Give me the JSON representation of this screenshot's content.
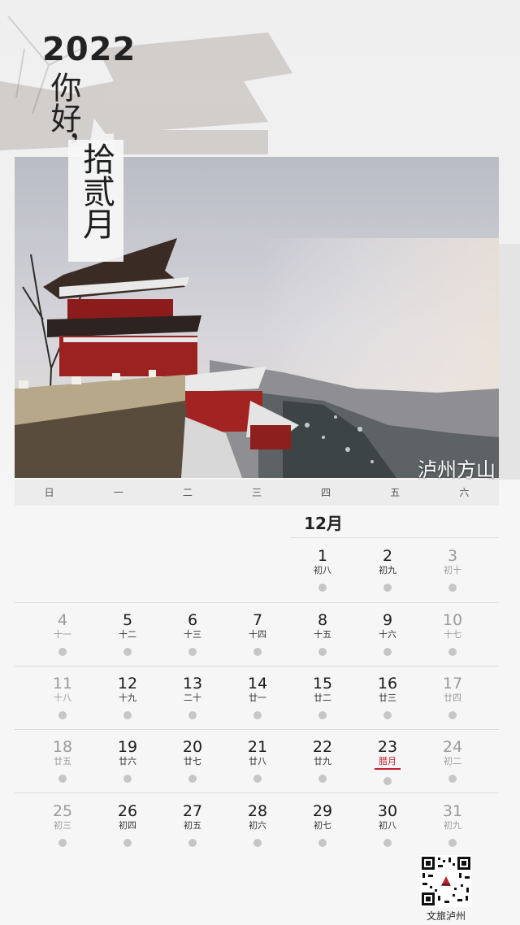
{
  "header": {
    "year": "2022",
    "greeting": "你好，",
    "month_title": "拾贰月"
  },
  "photo": {
    "caption": "泸州方山"
  },
  "calendar": {
    "weekdays": [
      "日",
      "一",
      "二",
      "三",
      "四",
      "五",
      "六"
    ],
    "month_label": "12月",
    "weeks": [
      [
        null,
        null,
        null,
        null,
        {
          "day": "1",
          "lunar": "初八"
        },
        {
          "day": "2",
          "lunar": "初九"
        },
        {
          "day": "3",
          "lunar": "初十"
        }
      ],
      [
        {
          "day": "4",
          "lunar": "十一"
        },
        {
          "day": "5",
          "lunar": "十二"
        },
        {
          "day": "6",
          "lunar": "十三"
        },
        {
          "day": "7",
          "lunar": "十四"
        },
        {
          "day": "8",
          "lunar": "十五"
        },
        {
          "day": "9",
          "lunar": "十六"
        },
        {
          "day": "10",
          "lunar": "十七"
        }
      ],
      [
        {
          "day": "11",
          "lunar": "十八"
        },
        {
          "day": "12",
          "lunar": "十九"
        },
        {
          "day": "13",
          "lunar": "二十"
        },
        {
          "day": "14",
          "lunar": "廿一"
        },
        {
          "day": "15",
          "lunar": "廿二"
        },
        {
          "day": "16",
          "lunar": "廿三"
        },
        {
          "day": "17",
          "lunar": "廿四"
        }
      ],
      [
        {
          "day": "18",
          "lunar": "廿五"
        },
        {
          "day": "19",
          "lunar": "廿六"
        },
        {
          "day": "20",
          "lunar": "廿七"
        },
        {
          "day": "21",
          "lunar": "廿八"
        },
        {
          "day": "22",
          "lunar": "廿九"
        },
        {
          "day": "23",
          "lunar": "腊月",
          "festival": true
        },
        {
          "day": "24",
          "lunar": "初二"
        }
      ],
      [
        {
          "day": "25",
          "lunar": "初三"
        },
        {
          "day": "26",
          "lunar": "初四"
        },
        {
          "day": "27",
          "lunar": "初五"
        },
        {
          "day": "28",
          "lunar": "初六"
        },
        {
          "day": "29",
          "lunar": "初七"
        },
        {
          "day": "30",
          "lunar": "初八"
        },
        {
          "day": "31",
          "lunar": "初九"
        }
      ]
    ]
  },
  "footer": {
    "qr_label": "文旅泸州"
  },
  "colors": {
    "festival": "#c0202e",
    "weekend_text": "#9a9a9a"
  }
}
